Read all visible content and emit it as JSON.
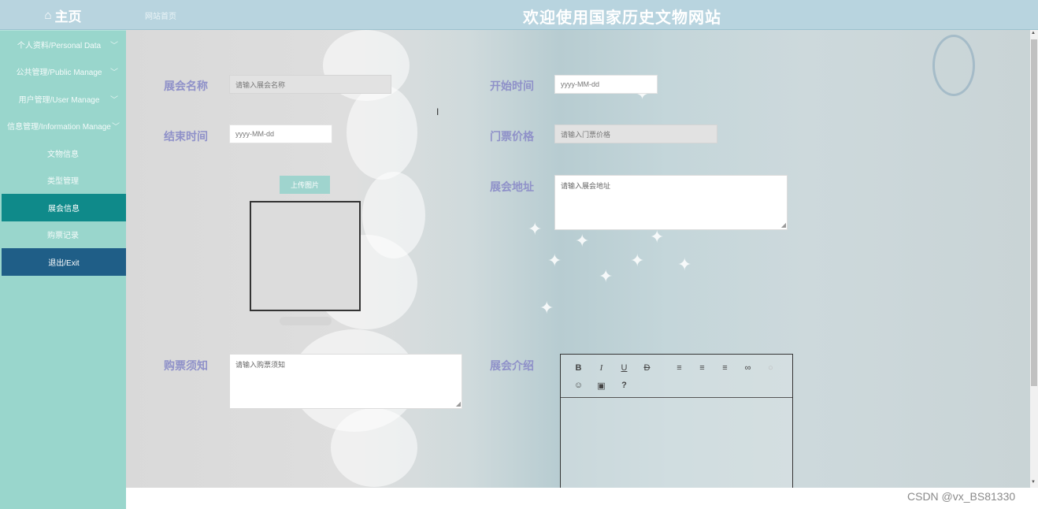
{
  "header": {
    "home_icon": "home-icon",
    "home_label": "主页",
    "breadcrumb": "网站首页",
    "site_title": "欢迎使用国家历史文物网站"
  },
  "sidebar": {
    "items": [
      {
        "label": "个人资料/Personal Data",
        "chevron": "﹀"
      },
      {
        "label": "公共管理/Public Manage",
        "chevron": "﹀"
      },
      {
        "label": "用户管理/User Manage",
        "chevron": "﹀"
      },
      {
        "label": "信息管理/Information Manage",
        "chevron": "﹀"
      },
      {
        "label": "文物信息"
      },
      {
        "label": "类型管理"
      },
      {
        "label": "展会信息"
      },
      {
        "label": "购票记录"
      },
      {
        "label": "退出/Exit"
      }
    ]
  },
  "form": {
    "name_label": "展会名称",
    "name_placeholder": "请输入展会名称",
    "start_label": "开始时间",
    "start_placeholder": "yyyy-MM-dd",
    "end_label": "结束时间",
    "end_placeholder": "yyyy-MM-dd",
    "price_label": "门票价格",
    "price_placeholder": "请输入门票价格",
    "upload_label": "上传图片",
    "address_label": "展会地址",
    "address_placeholder": "请输入展会地址",
    "notice_label": "购票须知",
    "notice_placeholder": "请输入购票须知",
    "intro_label": "展会介绍"
  },
  "editor_toolbar": {
    "bold": "B",
    "italic": "I",
    "underline": "U",
    "strike": "Đ",
    "help": "?"
  },
  "footer": {
    "watermark": "CSDN @vx_BS81330"
  },
  "colors": {
    "sidebar_bg": "#99d6cc",
    "active_item": "#0f8a8a",
    "exit_item": "#1f5e87",
    "label_color": "#8f91c9",
    "header_bg": "#b8d4df"
  }
}
